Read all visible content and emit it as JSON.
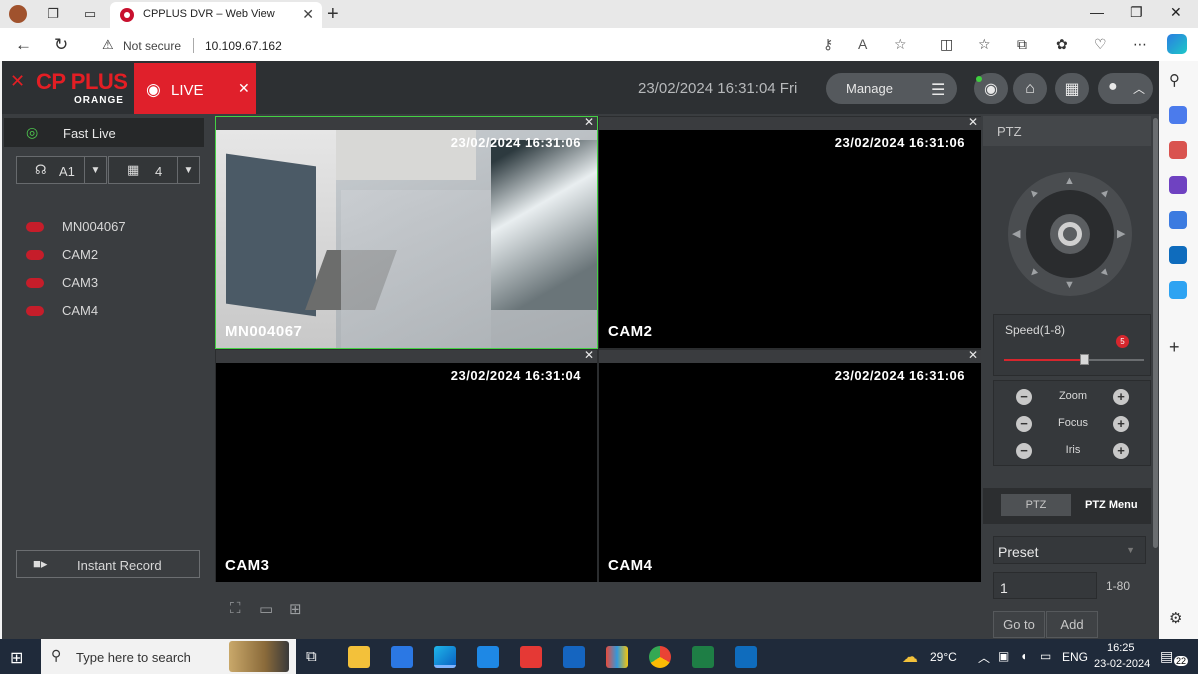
{
  "browser": {
    "tab_title": "CPPLUS DVR – Web View",
    "security_label": "Not secure",
    "url": "10.109.67.162"
  },
  "app": {
    "logo_text": "CP PLUS",
    "logo_sub": "ORANGE",
    "live_tab_label": "LIVE",
    "datetime": "23/02/2024 16:31:04 Fri",
    "manage_label": "Manage"
  },
  "left": {
    "fast_live_label": "Fast Live",
    "area_select": "A1",
    "layout_select": "4",
    "cameras": [
      "MN004067",
      "CAM2",
      "CAM3",
      "CAM4"
    ],
    "instant_record_label": "Instant Record"
  },
  "grid": {
    "cells": [
      {
        "name": "MN004067",
        "timestamp": "23/02/2024 16:31:06"
      },
      {
        "name": "CAM2",
        "timestamp": "23/02/2024 16:31:06"
      },
      {
        "name": "CAM3",
        "timestamp": "23/02/2024 16:31:04"
      },
      {
        "name": "CAM4",
        "timestamp": "23/02/2024 16:31:06"
      }
    ]
  },
  "ptz": {
    "header": "PTZ",
    "speed_label": "Speed(1-8)",
    "speed_value": "5",
    "speed_min": 1,
    "speed_max": 8,
    "zoom_label": "Zoom",
    "focus_label": "Focus",
    "iris_label": "Iris",
    "tab_ptz": "PTZ",
    "tab_menu": "PTZ Menu",
    "preset_select": "Preset",
    "preset_number": "1",
    "preset_range": "1-80",
    "goto_label": "Go to",
    "add_label": "Add"
  },
  "taskbar": {
    "search_placeholder": "Type here to search",
    "weather": "29°C",
    "language": "ENG",
    "time": "16:25",
    "date": "23-02-2024",
    "notifications": "22"
  },
  "colors": {
    "accent_red": "#e0202b",
    "active_green": "#44d144",
    "app_bg": "#3a3d40"
  }
}
